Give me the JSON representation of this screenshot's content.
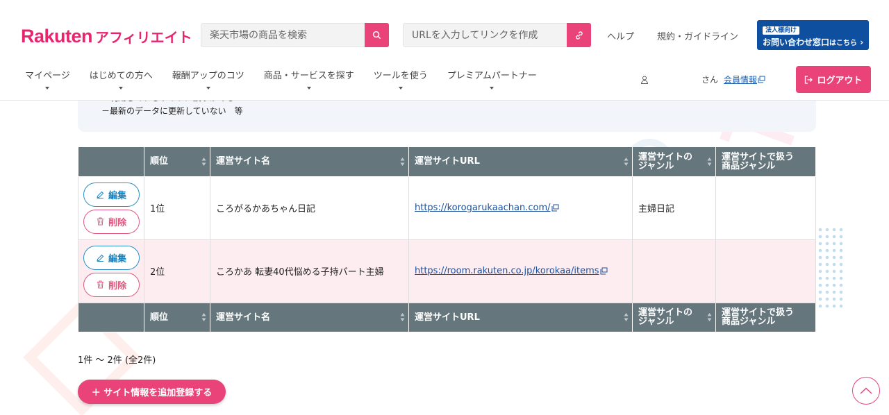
{
  "header": {
    "logo_main": "Rakuten",
    "logo_sub": "アフィリエイト",
    "search_placeholder": "楽天市場の商品を検索",
    "url_placeholder": "URLを入力してリンクを作成",
    "help_label": "ヘルプ",
    "terms_label": "規約・ガイドライン",
    "corp_tag": "法人様向け",
    "corp_main": "お問い合わせ窓口",
    "corp_small": "はこちら",
    "accent_color": "#e9437a"
  },
  "nav": {
    "items": [
      {
        "label": "マイページ"
      },
      {
        "label": "はじめての方へ"
      },
      {
        "label": "報酬アップのコツ"
      },
      {
        "label": "商品・サービスを探す"
      },
      {
        "label": "ツールを使う"
      },
      {
        "label": "プレミアムパートナー"
      }
    ]
  },
  "user": {
    "name_suffix": "さん",
    "member_info_label": "会員情報",
    "logout_label": "ログアウト"
  },
  "info": {
    "line1": "－利用しているサイトに誤りがある",
    "line2": "－最新のデータに更新していない　等"
  },
  "table": {
    "headers": [
      "順位",
      "運営サイト名",
      "運営サイトURL",
      "運営サイトの\nジャンル",
      "運営サイトで扱う\n商品ジャンル"
    ],
    "edit_label": "編集",
    "delete_label": "削除",
    "rows": [
      {
        "rank": "1位",
        "name": "ころがるかあちゃん日記",
        "url": "https://korogarukaachan.com/",
        "genre": "主婦日記",
        "product_genre": ""
      },
      {
        "rank": "2位",
        "name": "ころかあ 転妻40代悩める子持パート主婦",
        "url": "https://room.rakuten.co.jp/korokaa/items",
        "genre": "",
        "product_genre": ""
      }
    ]
  },
  "footer": {
    "count_text": "1件 ～ 2件 (全2件)",
    "add_button_label": "＋ サイト情報を追加登録する"
  }
}
